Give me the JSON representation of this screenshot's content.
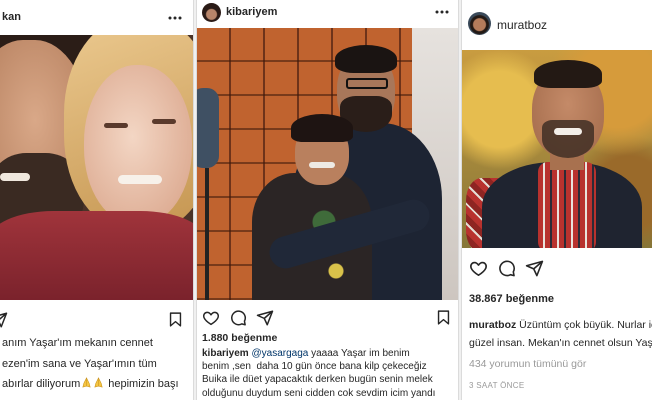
{
  "colors": {
    "text": "#262626",
    "mention": "#003569",
    "muted": "#999999",
    "divider": "#dbdbdb",
    "page_background": "#f0f0f0"
  },
  "post_left": {
    "header": {
      "username": "kan",
      "menu_icon": "more-options-icon"
    },
    "actions": {
      "icons": [
        "send-icon",
        "bookmark-icon"
      ]
    },
    "caption": {
      "line1": "anım Yaşar'ım mekanın cennet",
      "line2": "ezen'im sana ve Yaşar'ımın tüm",
      "line3_start": "abırlar diliyorum",
      "line3_emoji_icon": "folded-hands-emoji-icon",
      "line3_end": "hepimizin başı"
    }
  },
  "post_middle": {
    "header": {
      "username": "kibariyem",
      "menu_icon": "more-options-icon"
    },
    "actions": {
      "icons": [
        "heart-icon",
        "comment-icon",
        "send-icon",
        "bookmark-icon"
      ]
    },
    "likes": "1.880 beğenme",
    "caption": {
      "author": "kibariyem",
      "mention": "@yasargaga",
      "line1": "yaaaa Yaşar im benim",
      "line2": "benim ,sen  daha 10 gün önce bana kilp çekeceğiz",
      "line3": "Buika ile düet yapacaktık derken bugün senin melek",
      "line4": "olduğunu duydum seni cidden cok sevdim icim yandı"
    }
  },
  "post_right": {
    "header": {
      "username": "muratboz"
    },
    "actions": {
      "icons": [
        "heart-icon",
        "comment-icon",
        "send-icon"
      ]
    },
    "likes": "38.867 beğenme",
    "caption": {
      "author": "muratboz",
      "line1": "Üzüntüm çok büyük. Nurlar iç",
      "line2": "güzel insan. Mekan'ın cennet olsun Yaşa"
    },
    "view_comments": "434 yorumun tümünü gör",
    "timestamp": "3 SAAT ÖNCE"
  }
}
